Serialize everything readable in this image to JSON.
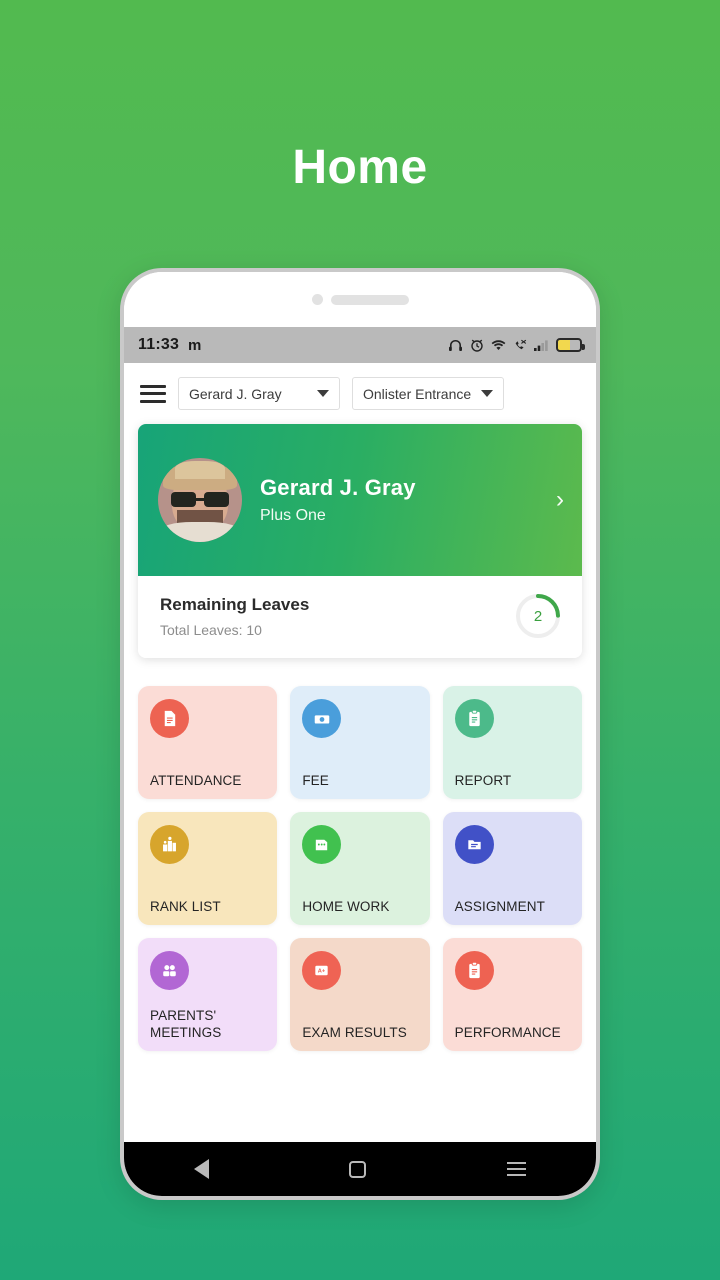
{
  "page": {
    "title": "Home",
    "bg_top": "#52ba4f",
    "bg_bottom": "#1fa877"
  },
  "status_bar": {
    "time": "11:33",
    "carrier_glyph": "m",
    "icons": [
      "headphones-icon",
      "alarm-icon",
      "wifi-icon",
      "call-mute-icon",
      "signal-icon",
      "battery-icon"
    ]
  },
  "toolbar": {
    "menu_icon": "hamburger-icon",
    "student_select": "Gerard J. Gray",
    "institution_select": "Onlister Entrance"
  },
  "profile_card": {
    "name": "Gerard J. Gray",
    "subtitle": "Plus One",
    "chevron": "›",
    "leaves_title": "Remaining Leaves",
    "leaves_total_text": "Total Leaves: 10",
    "leaves_remaining": "2",
    "leaves_total": 10,
    "ring_color": "#3fa74a",
    "ring_track": "#eeeeee",
    "gradient_from": "#17a478",
    "gradient_to": "#5cba4d"
  },
  "tiles": [
    {
      "label": "ATTENDANCE",
      "icon": "document-icon",
      "bg": "#fbdcd6",
      "icon_bg": "#ed6352"
    },
    {
      "label": "FEE",
      "icon": "money-icon",
      "bg": "#dfedf9",
      "icon_bg": "#4a9edb"
    },
    {
      "label": "REPORT",
      "icon": "clipboard-icon",
      "bg": "#d9f2e7",
      "icon_bg": "#4cba8a"
    },
    {
      "label": "RANK LIST",
      "icon": "podium-icon",
      "bg": "#f8e6bc",
      "icon_bg": "#d7a52c"
    },
    {
      "label": "HOME WORK",
      "icon": "book-icon",
      "bg": "#dcf2de",
      "icon_bg": "#41c14f"
    },
    {
      "label": "ASSIGNMENT",
      "icon": "file-text-icon",
      "bg": "#dcdef7",
      "icon_bg": "#4151c7"
    },
    {
      "label": "PARENTS' MEETINGS",
      "icon": "group-icon",
      "bg": "#f2ddf9",
      "icon_bg": "#b267d4"
    },
    {
      "label": "EXAM RESULTS",
      "icon": "grade-icon",
      "bg": "#f4d9c9",
      "icon_bg": "#ef6354"
    },
    {
      "label": "PERFORMANCE",
      "icon": "clipboard-check-icon",
      "bg": "#fbdcd6",
      "icon_bg": "#ee6252"
    }
  ],
  "nav_bar": {
    "back": "back-icon",
    "home": "home-icon",
    "recents": "recents-icon"
  }
}
